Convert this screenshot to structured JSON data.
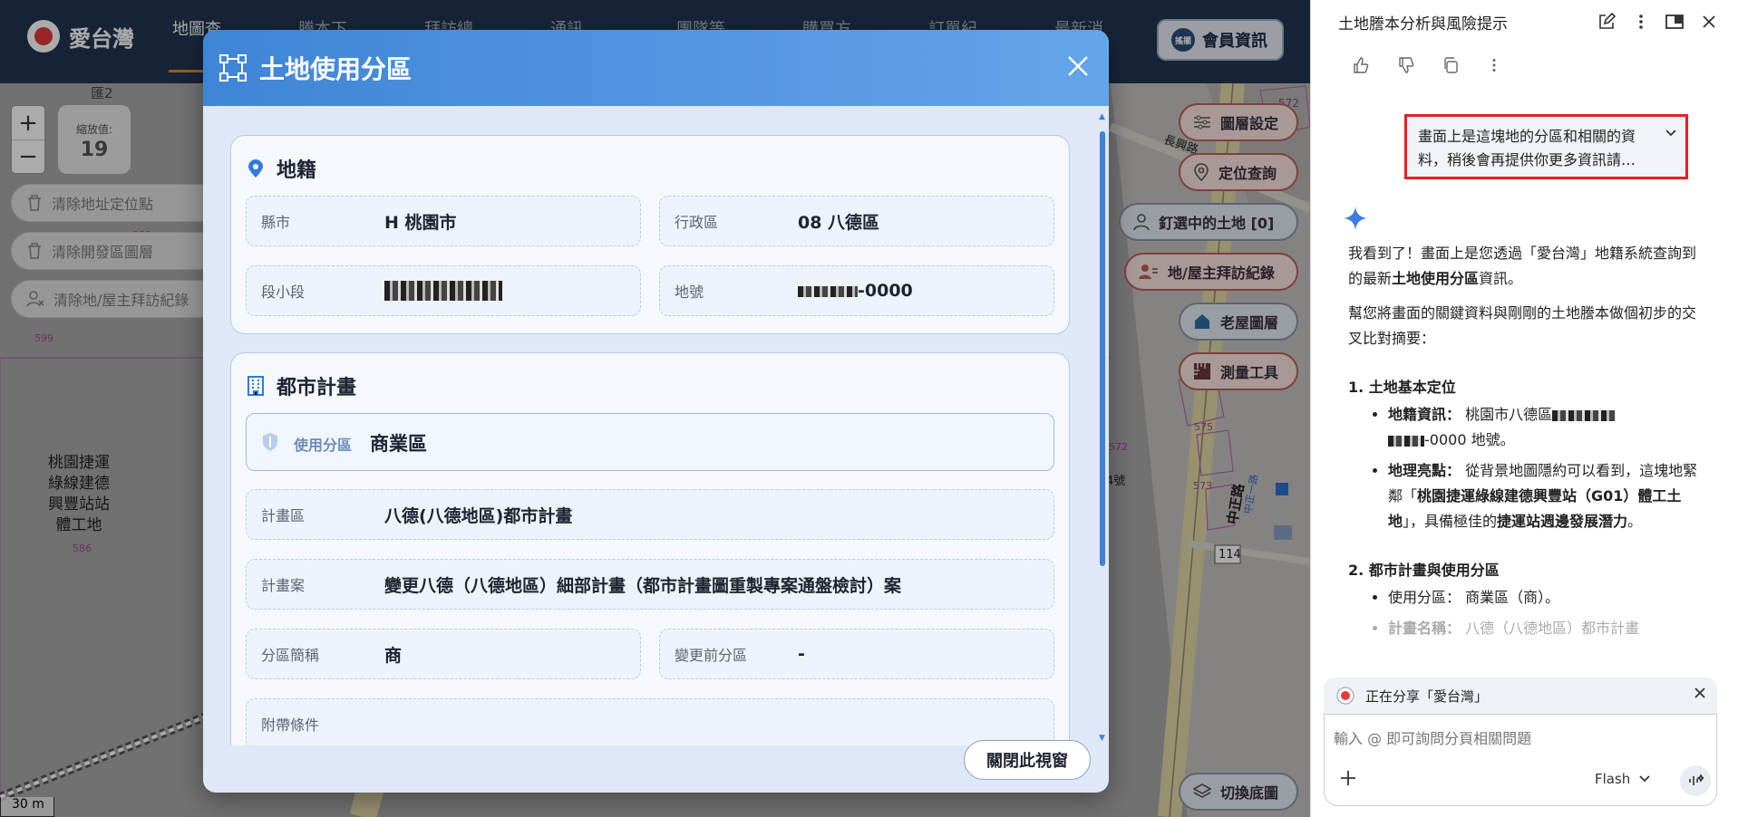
{
  "app": {
    "logo_text": "愛台灣",
    "nav_items": [
      "地圖查",
      "謄本下",
      "拜訪總",
      "通訊",
      "團隊等",
      "購買方",
      "訂單紀",
      "最新消"
    ],
    "member_button": "會員資訊",
    "member_avatar": "搖擺"
  },
  "map": {
    "zoom_in": "+",
    "zoom_out": "−",
    "zoom_label": "縮放值:",
    "zoom_value": "19",
    "left_buttons": [
      "清除地址定位點",
      "清除開發區圖層",
      "清除地/屋主拜訪紀錄"
    ],
    "right_tools": {
      "layers": "圖層設定",
      "locate": "定位查詢",
      "pinned": "釘選中的土地 [0]",
      "visits": "地/屋主拜訪紀錄",
      "old_house": "老屋圖層",
      "measure": "測量工具",
      "basemap": "切換底圖"
    },
    "station_label": "桃園捷運綠線建德興豐站站體工地",
    "road_label": "中正路",
    "road_number": "114",
    "scale": "30 m",
    "num_labels": {
      "a": "匯2",
      "b": "599",
      "c": "585",
      "d": "586",
      "e": "572",
      "f": "575",
      "g": "573",
      "h": "4號",
      "i": "中正一路",
      "j": "長興路"
    }
  },
  "modal": {
    "title": "土地使用分區",
    "close_button": "關閉此視窗",
    "cadastral": {
      "heading": "地籍",
      "city_label": "縣市",
      "city_value": "H 桃園市",
      "district_label": "行政區",
      "district_value": "08 八德區",
      "section_label": "段小段",
      "lot_label": "地號",
      "lot_suffix": "-0000"
    },
    "urban_plan": {
      "heading": "都市計畫",
      "zone_label": "使用分區",
      "zone_value": "商業區",
      "plan_area_label": "計畫區",
      "plan_area_value": "八德(八德地區)都市計畫",
      "plan_case_label": "計畫案",
      "plan_case_value": "變更八德（八德地區）細部計畫（都市計畫圖重製專案通盤檢討）案",
      "zone_abbr_label": "分區簡稱",
      "zone_abbr_value": "商",
      "prev_zone_label": "變更前分區",
      "prev_zone_value": "-",
      "next_label": "附帶條件"
    }
  },
  "panel": {
    "title": "土地謄本分析與風險提示",
    "query": "畫面上是這塊地的分區和相關的資料，稍後會再提供你更多資訊請…",
    "intro_1": "我看到了！畫面上是您透過「愛台灣」地籍系統查詢到的最新",
    "intro_bold": "土地使用分區",
    "intro_2": "資訊。",
    "intro_p2": "幫您將畫面的關鍵資料與剛剛的土地謄本做個初步的交叉比對摘要：",
    "s1_heading": "1. 土地基本定位",
    "s1_b1_label": "地籍資訊：",
    "s1_b1_text": "桃園市八德區",
    "s1_b1_suffix": "-0000 地號。",
    "s1_b2_label": "地理亮點：",
    "s1_b2_text": "從背景地圖隱約可以看到，這塊地緊鄰「",
    "s1_b2_bold": "桃園捷運綠線建德興豐站（G01）體工土地",
    "s1_b2_text2": "」，具備極佳的",
    "s1_b2_bold2": "捷運站週邊發展潛力",
    "s1_b2_end": "。",
    "s2_heading": "2. 都市計畫與使用分區",
    "s2_b1_label": "使用分區：",
    "s2_b1_text": "商業區（商）。",
    "s2_b2_label": "計畫名稱：",
    "s2_b2_text": "八德（八德地區）都市計畫",
    "share_text": "正在分享「愛台灣」",
    "input_placeholder": "輸入 @ 即可詢問分頁相關問題",
    "model": "Flash"
  },
  "colors": {
    "topbar": "#233654",
    "modal_header": "#3f85d6",
    "tool_border": "#b9615c",
    "highlight": "#e52020"
  }
}
